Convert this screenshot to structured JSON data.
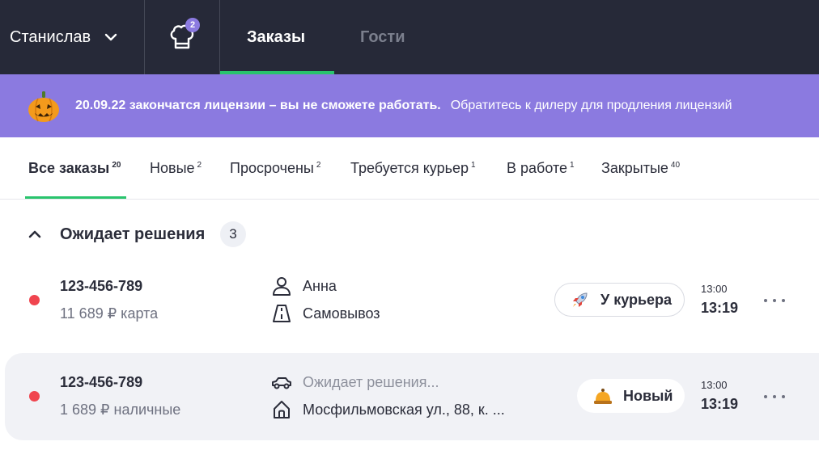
{
  "header": {
    "user_name": "Станислав",
    "chef_badge_count": "2",
    "tabs": [
      {
        "label": "Заказы",
        "active": true
      },
      {
        "label": "Гости",
        "active": false
      }
    ]
  },
  "banner": {
    "bold_text": "20.09.22 закончатся лицензии – вы не сможете работать.",
    "text": "Обратитесь к дилеру для продления лицензий",
    "icon": "pumpkin-icon"
  },
  "filters": [
    {
      "label": "Все заказы",
      "count": "20",
      "active": true
    },
    {
      "label": "Новые",
      "count": "2",
      "active": false
    },
    {
      "label": "Просрочены",
      "count": "2",
      "active": false
    },
    {
      "label": "Требуется курьер",
      "count": "1",
      "active": false
    },
    {
      "label": "В работе",
      "count": "1",
      "active": false
    },
    {
      "label": "Закрытые",
      "count": "40",
      "active": false
    }
  ],
  "group": {
    "title": "Ожидает решения",
    "count": "3"
  },
  "orders": [
    {
      "number": "123-456-789",
      "sum": "11 689 ₽ карта",
      "customer": "Анна",
      "customer_icon": "person-icon",
      "delivery": "Самовывоз",
      "delivery_icon": "road-icon",
      "status": "У курьера",
      "status_icon": "rocket-icon",
      "time_planned": "13:00",
      "time_actual": "13:19"
    },
    {
      "number": "123-456-789",
      "sum": "1 689 ₽ наличные",
      "customer": "Ожидает решения...",
      "customer_icon": "car-icon",
      "delivery": "Мосфильмовская ул., 88, к. ...",
      "delivery_icon": "house-icon",
      "status": "Новый",
      "status_icon": "bell-icon",
      "time_planned": "13:00",
      "time_actual": "13:19"
    }
  ],
  "colors": {
    "topbar": "#262938",
    "banner": "#8b7ae0",
    "accent_green": "#29c46d",
    "status_dot": "#f0454f"
  }
}
